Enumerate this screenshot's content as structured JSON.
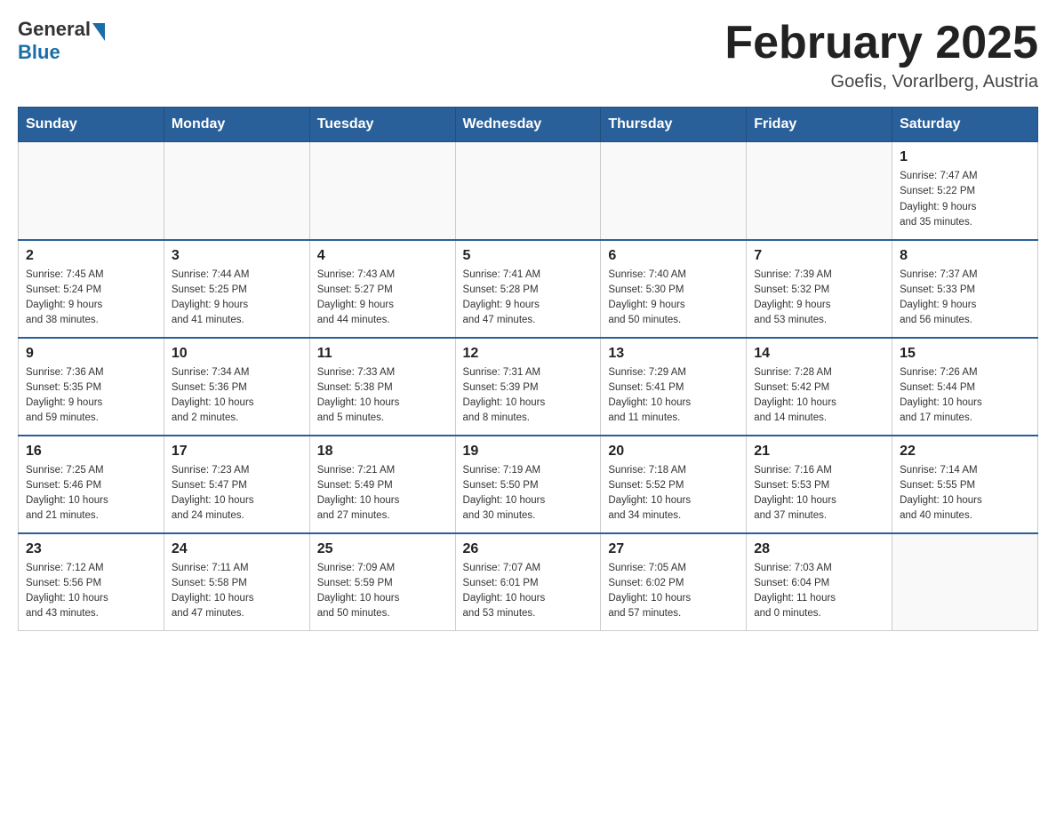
{
  "header": {
    "logo_general": "General",
    "logo_blue": "Blue",
    "title": "February 2025",
    "subtitle": "Goefis, Vorarlberg, Austria"
  },
  "weekdays": [
    "Sunday",
    "Monday",
    "Tuesday",
    "Wednesday",
    "Thursday",
    "Friday",
    "Saturday"
  ],
  "weeks": [
    [
      {
        "day": "",
        "info": ""
      },
      {
        "day": "",
        "info": ""
      },
      {
        "day": "",
        "info": ""
      },
      {
        "day": "",
        "info": ""
      },
      {
        "day": "",
        "info": ""
      },
      {
        "day": "",
        "info": ""
      },
      {
        "day": "1",
        "info": "Sunrise: 7:47 AM\nSunset: 5:22 PM\nDaylight: 9 hours\nand 35 minutes."
      }
    ],
    [
      {
        "day": "2",
        "info": "Sunrise: 7:45 AM\nSunset: 5:24 PM\nDaylight: 9 hours\nand 38 minutes."
      },
      {
        "day": "3",
        "info": "Sunrise: 7:44 AM\nSunset: 5:25 PM\nDaylight: 9 hours\nand 41 minutes."
      },
      {
        "day": "4",
        "info": "Sunrise: 7:43 AM\nSunset: 5:27 PM\nDaylight: 9 hours\nand 44 minutes."
      },
      {
        "day": "5",
        "info": "Sunrise: 7:41 AM\nSunset: 5:28 PM\nDaylight: 9 hours\nand 47 minutes."
      },
      {
        "day": "6",
        "info": "Sunrise: 7:40 AM\nSunset: 5:30 PM\nDaylight: 9 hours\nand 50 minutes."
      },
      {
        "day": "7",
        "info": "Sunrise: 7:39 AM\nSunset: 5:32 PM\nDaylight: 9 hours\nand 53 minutes."
      },
      {
        "day": "8",
        "info": "Sunrise: 7:37 AM\nSunset: 5:33 PM\nDaylight: 9 hours\nand 56 minutes."
      }
    ],
    [
      {
        "day": "9",
        "info": "Sunrise: 7:36 AM\nSunset: 5:35 PM\nDaylight: 9 hours\nand 59 minutes."
      },
      {
        "day": "10",
        "info": "Sunrise: 7:34 AM\nSunset: 5:36 PM\nDaylight: 10 hours\nand 2 minutes."
      },
      {
        "day": "11",
        "info": "Sunrise: 7:33 AM\nSunset: 5:38 PM\nDaylight: 10 hours\nand 5 minutes."
      },
      {
        "day": "12",
        "info": "Sunrise: 7:31 AM\nSunset: 5:39 PM\nDaylight: 10 hours\nand 8 minutes."
      },
      {
        "day": "13",
        "info": "Sunrise: 7:29 AM\nSunset: 5:41 PM\nDaylight: 10 hours\nand 11 minutes."
      },
      {
        "day": "14",
        "info": "Sunrise: 7:28 AM\nSunset: 5:42 PM\nDaylight: 10 hours\nand 14 minutes."
      },
      {
        "day": "15",
        "info": "Sunrise: 7:26 AM\nSunset: 5:44 PM\nDaylight: 10 hours\nand 17 minutes."
      }
    ],
    [
      {
        "day": "16",
        "info": "Sunrise: 7:25 AM\nSunset: 5:46 PM\nDaylight: 10 hours\nand 21 minutes."
      },
      {
        "day": "17",
        "info": "Sunrise: 7:23 AM\nSunset: 5:47 PM\nDaylight: 10 hours\nand 24 minutes."
      },
      {
        "day": "18",
        "info": "Sunrise: 7:21 AM\nSunset: 5:49 PM\nDaylight: 10 hours\nand 27 minutes."
      },
      {
        "day": "19",
        "info": "Sunrise: 7:19 AM\nSunset: 5:50 PM\nDaylight: 10 hours\nand 30 minutes."
      },
      {
        "day": "20",
        "info": "Sunrise: 7:18 AM\nSunset: 5:52 PM\nDaylight: 10 hours\nand 34 minutes."
      },
      {
        "day": "21",
        "info": "Sunrise: 7:16 AM\nSunset: 5:53 PM\nDaylight: 10 hours\nand 37 minutes."
      },
      {
        "day": "22",
        "info": "Sunrise: 7:14 AM\nSunset: 5:55 PM\nDaylight: 10 hours\nand 40 minutes."
      }
    ],
    [
      {
        "day": "23",
        "info": "Sunrise: 7:12 AM\nSunset: 5:56 PM\nDaylight: 10 hours\nand 43 minutes."
      },
      {
        "day": "24",
        "info": "Sunrise: 7:11 AM\nSunset: 5:58 PM\nDaylight: 10 hours\nand 47 minutes."
      },
      {
        "day": "25",
        "info": "Sunrise: 7:09 AM\nSunset: 5:59 PM\nDaylight: 10 hours\nand 50 minutes."
      },
      {
        "day": "26",
        "info": "Sunrise: 7:07 AM\nSunset: 6:01 PM\nDaylight: 10 hours\nand 53 minutes."
      },
      {
        "day": "27",
        "info": "Sunrise: 7:05 AM\nSunset: 6:02 PM\nDaylight: 10 hours\nand 57 minutes."
      },
      {
        "day": "28",
        "info": "Sunrise: 7:03 AM\nSunset: 6:04 PM\nDaylight: 11 hours\nand 0 minutes."
      },
      {
        "day": "",
        "info": ""
      }
    ]
  ]
}
